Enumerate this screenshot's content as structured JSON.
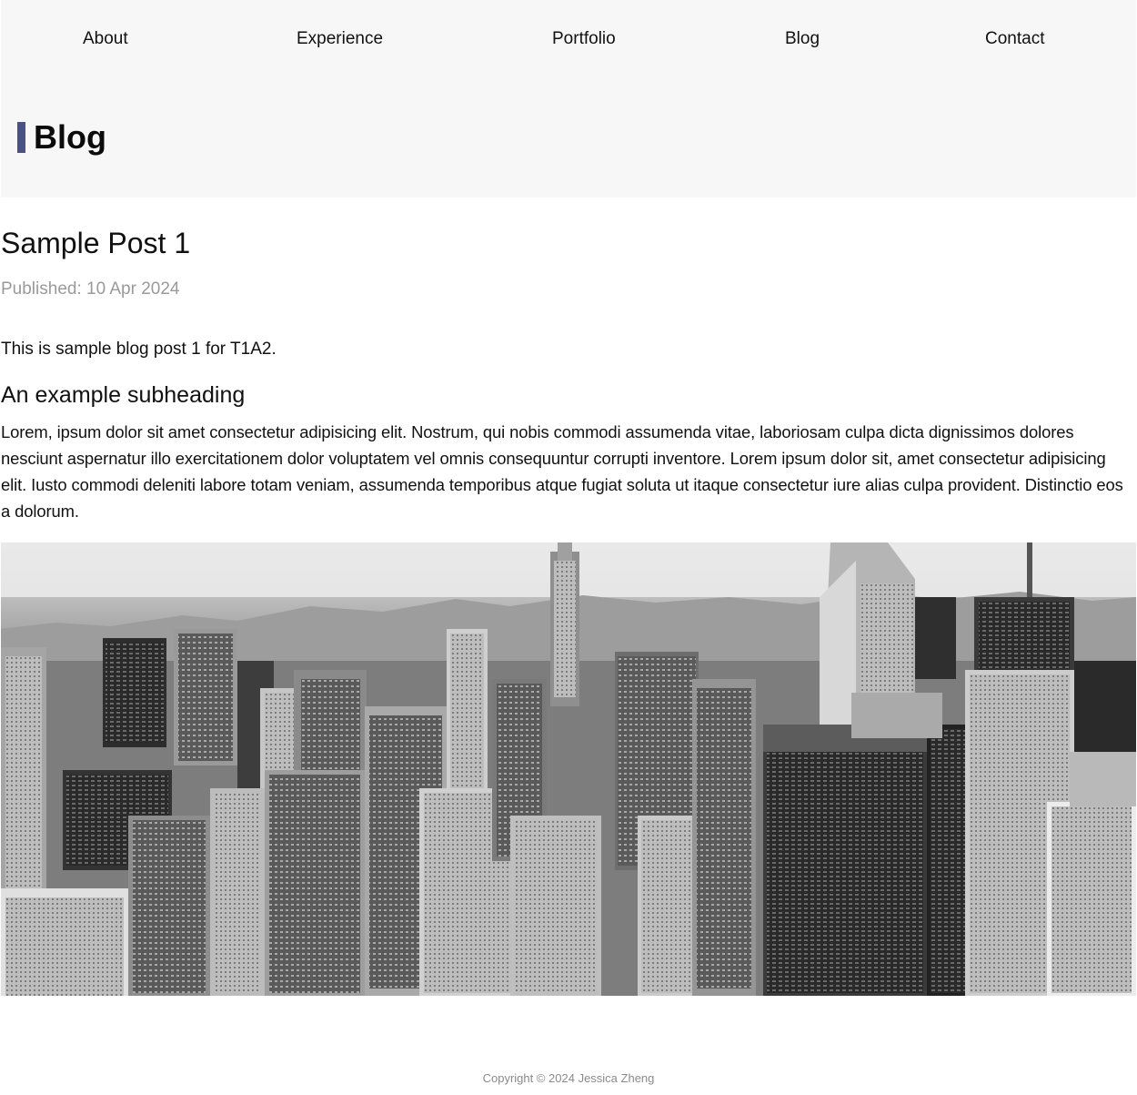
{
  "nav": {
    "items": [
      {
        "label": "About"
      },
      {
        "label": "Experience"
      },
      {
        "label": "Portfolio"
      },
      {
        "label": "Blog"
      },
      {
        "label": "Contact"
      }
    ]
  },
  "header": {
    "title": "Blog",
    "accent_color": "#4a5285"
  },
  "post": {
    "title": "Sample Post 1",
    "published": "Published: 10 Apr 2024",
    "intro": "This is sample blog post 1 for T1A2.",
    "subheading": "An example subheading",
    "body": "Lorem, ipsum dolor sit amet consectetur adipisicing elit. Nostrum, qui nobis commodi assumenda vitae, laboriosam culpa dicta dignissimos dolores nesciunt aspernatur illo exercitationem dolor voluptatem vel omnis consequuntur corrupti inventore. Lorem ipsum dolor sit, amet consectetur adipisicing elit. Iusto commodi deleniti labore totam veniam, assumenda temporibus atque fugiat soluta ut itaque consectetur iure alias culpa provident. Distinctio eos a dolorum.",
    "image": {
      "icon": "city-skyline-photo"
    }
  },
  "footer": {
    "copyright": "Copyright © 2024 Jessica Zheng"
  }
}
